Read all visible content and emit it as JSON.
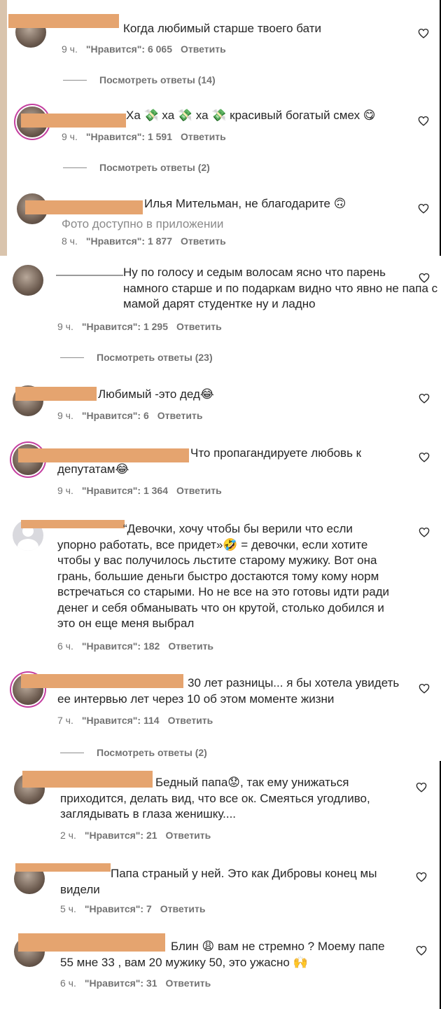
{
  "comments": [
    {
      "text": "Когда любимый старше твоего бати",
      "time": "9 ч.",
      "likes": "\"Нравится\": 6 065",
      "reply": "Ответить",
      "view_replies": "Посмотреть ответы (14)"
    },
    {
      "text": "Ха 💸 ха 💸 ха 💸 красивый богатый смех 😋",
      "time": "9 ч.",
      "likes": "\"Нравится\": 1 591",
      "reply": "Ответить",
      "view_replies": "Посмотреть ответы (2)"
    },
    {
      "text": "Илья Мительман, не благодарите 🙃",
      "photo_note": "Фото доступно в приложении",
      "time": "8 ч.",
      "likes": "\"Нравится\": 1 877",
      "reply": "Ответить"
    },
    {
      "text": "Ну по голосу и седым волосам ясно что парень\nнамного старше и по подаркам видно что явно не папа с\nмамой дарят студентке ну и ладно",
      "time": "9 ч.",
      "likes": "\"Нравится\": 1 295",
      "reply": "Ответить",
      "view_replies": "Посмотреть ответы (23)"
    },
    {
      "text": "Любимый -это дед😂",
      "time": "9 ч.",
      "likes": "\"Нравится\": 6",
      "reply": "Ответить"
    },
    {
      "text": "Что пропагандируете любовь к\nдепутатам😂",
      "time": "9 ч.",
      "likes": "\"Нравится\": 1 364",
      "reply": "Ответить"
    },
    {
      "text": "“Девочки, хочу чтобы бы верили что если\nупорно работать, все придет»🤣 = девочки, если хотите\nчтобы у вас получилось льстите старому мужику. Вот она\nгрань, большие деньги быстро достаются тому кому норм\nвстречаться со старыми. Но не все на это готовы идти ради\nденег и себя обманывать что он крутой, столько добился и\nэто он еще меня выбрал",
      "time": "6 ч.",
      "likes": "\"Нравится\": 182",
      "reply": "Ответить"
    },
    {
      "text": "30 лет разницы... я бы хотела увидеть\nее интервью лет через 10 об этом моменте жизни",
      "time": "7 ч.",
      "likes": "\"Нравится\": 114",
      "reply": "Ответить",
      "view_replies": "Посмотреть ответы (2)"
    },
    {
      "text": "Бедный папа😟, так ему унижаться\nприходится, делать вид, что все ок. Смеяться угодливо,\nзаглядывать в глаза женишку....",
      "time": "2 ч.",
      "likes": "\"Нравится\": 21",
      "reply": "Ответить"
    },
    {
      "text": "Папа страный у ней. Это как Дибровы конец мы\nвидели",
      "time": "5 ч.",
      "likes": "\"Нравится\": 7",
      "reply": "Ответить"
    },
    {
      "text": "Блин 😩 вам не стремно ? Моему папе\n55 мне 33 , вам 20 мужику 50, это ужасно 🙌",
      "time": "6 ч.",
      "likes": "\"Нравится\": 31",
      "reply": "Ответить"
    }
  ],
  "colors": {
    "redaction": "#e5a46f",
    "meta_text": "#737373",
    "body_text": "#262626",
    "story_ring": "#c43fa0"
  },
  "icons": {
    "like": "heart-outline-icon"
  }
}
